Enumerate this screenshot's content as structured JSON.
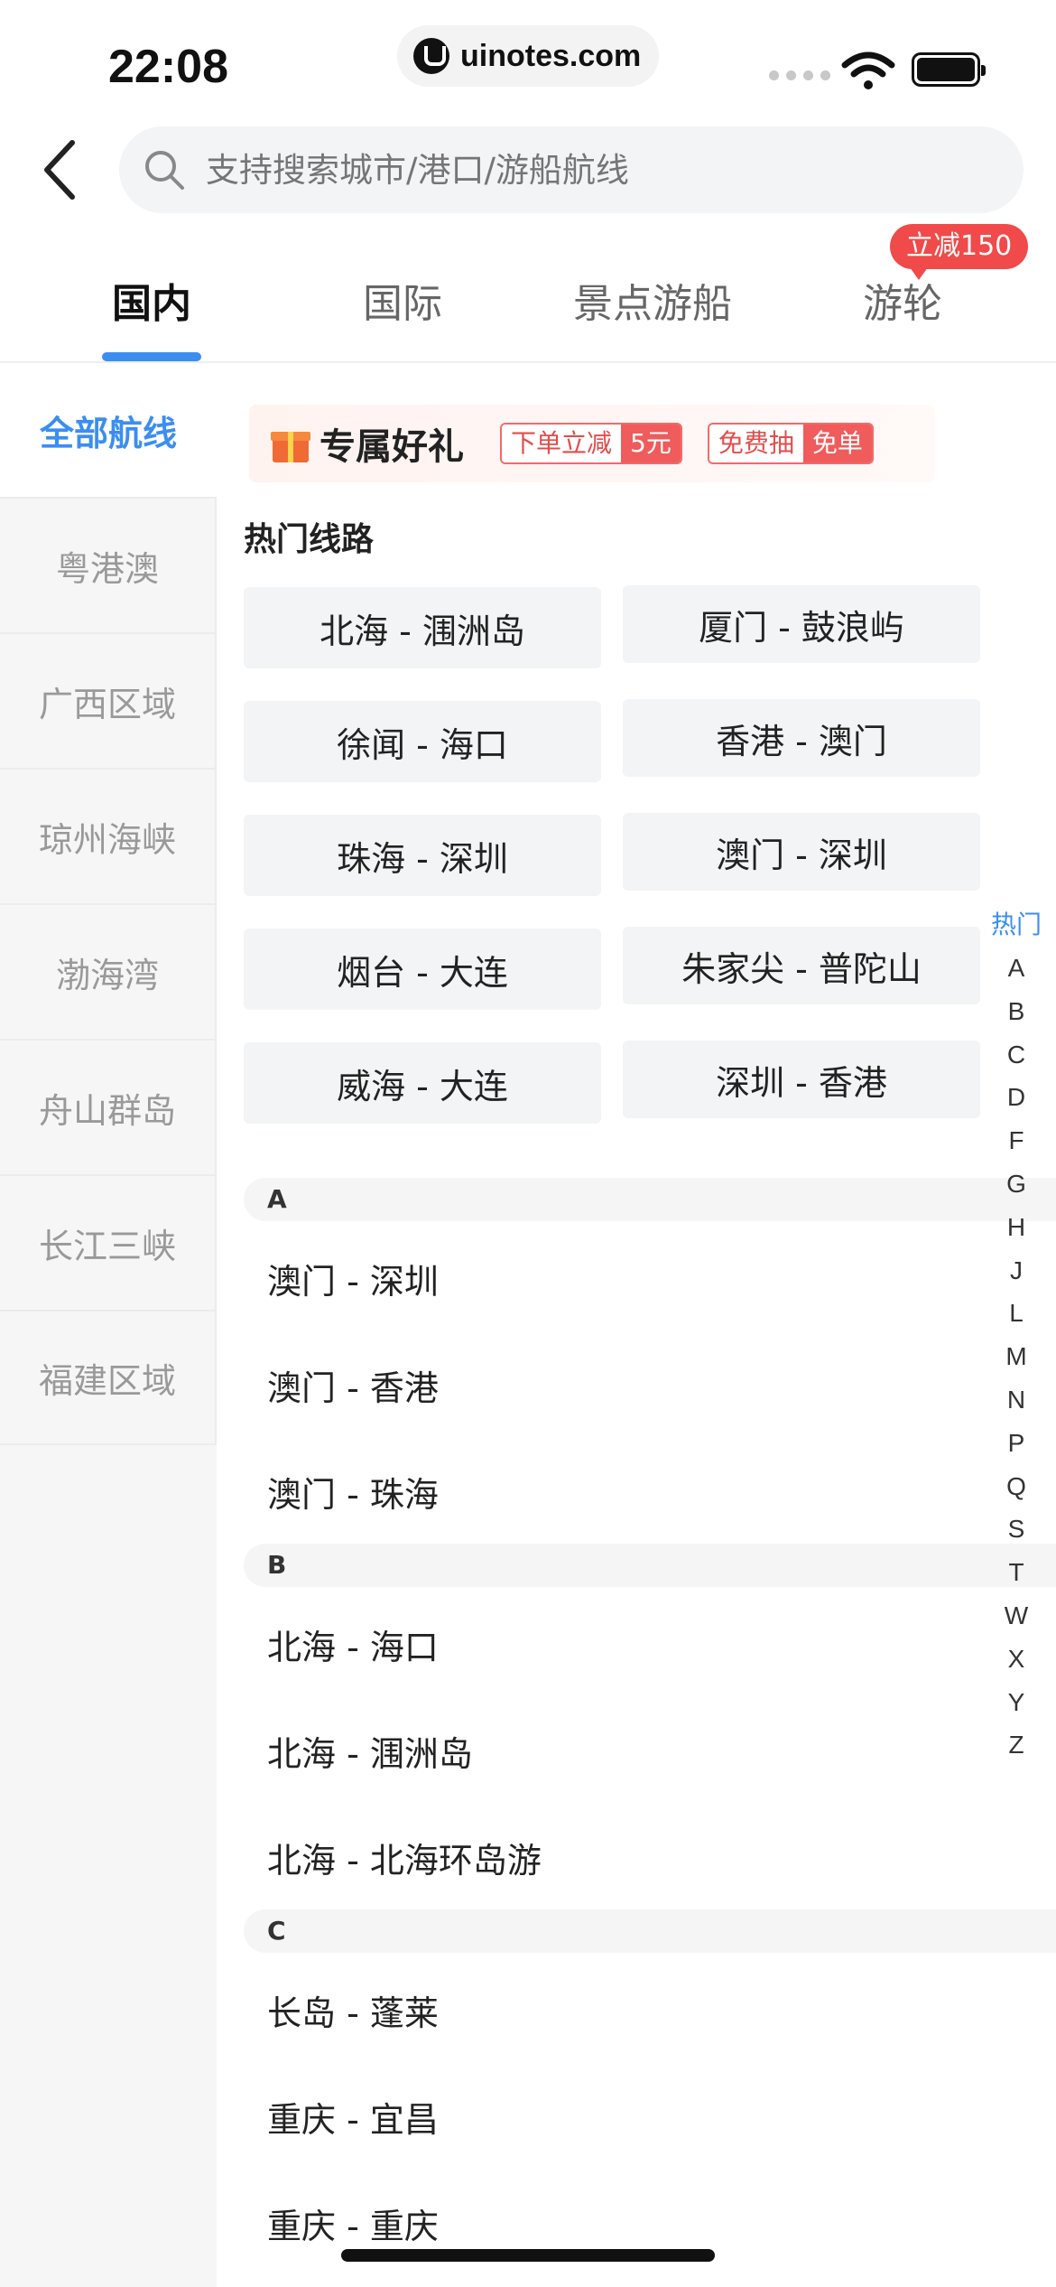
{
  "status_bar": {
    "time": "22:08",
    "url": "uinotes.com"
  },
  "search": {
    "placeholder": "支持搜索城市/港口/游船航线"
  },
  "tabs": [
    {
      "label": "国内",
      "active": true
    },
    {
      "label": "国际",
      "active": false
    },
    {
      "label": "景点游船",
      "active": false
    },
    {
      "label": "游轮",
      "active": false
    }
  ],
  "tab_badge": "立减150",
  "sidebar": {
    "active": "全部航线",
    "items": [
      "粤港澳",
      "广西区域",
      "琼州海峡",
      "渤海湾",
      "舟山群岛",
      "长江三峡",
      "福建区域"
    ]
  },
  "promo": {
    "title": "专属好礼",
    "tag1_left": "下单立减",
    "tag1_right": "5元",
    "tag2_left": "免费抽",
    "tag2_right": "免单"
  },
  "hot": {
    "title": "热门线路",
    "routes": [
      "北海 - 涠洲岛",
      "厦门 - 鼓浪屿",
      "徐闻 - 海口",
      "香港 - 澳门",
      "珠海 - 深圳",
      "澳门 - 深圳",
      "烟台 - 大连",
      "朱家尖 - 普陀山",
      "威海 - 大连",
      "深圳 - 香港"
    ]
  },
  "groups": [
    {
      "letter": "A",
      "routes": [
        "澳门 - 深圳",
        "澳门 - 香港",
        "澳门 - 珠海"
      ]
    },
    {
      "letter": "B",
      "routes": [
        "北海 - 海口",
        "北海 - 涠洲岛",
        "北海 - 北海环岛游"
      ]
    },
    {
      "letter": "C",
      "routes": [
        "长岛 - 蓬莱",
        "重庆 - 宜昌",
        "重庆 - 重庆"
      ]
    }
  ],
  "index": {
    "hot": "热门",
    "letters": [
      "A",
      "B",
      "C",
      "D",
      "F",
      "G",
      "H",
      "J",
      "L",
      "M",
      "N",
      "P",
      "Q",
      "S",
      "T",
      "W",
      "X",
      "Y",
      "Z"
    ]
  },
  "colors": {
    "accent": "#3b8ef0",
    "badge": "#f04a4a"
  }
}
